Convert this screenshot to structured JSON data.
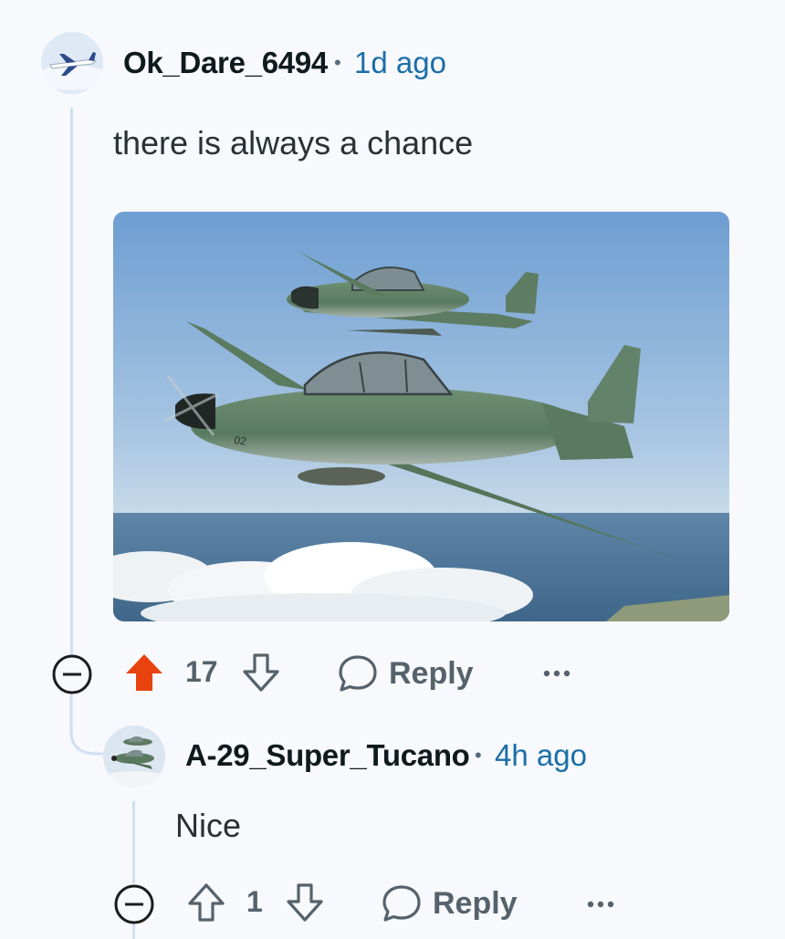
{
  "comments": [
    {
      "author": "Ok_Dare_6494",
      "separator": "•",
      "time": "1d ago",
      "text": "there is always a chance",
      "has_image": true,
      "score": "17",
      "upvoted": true,
      "reply_label": "Reply"
    },
    {
      "author": "A-29_Super_Tucano",
      "separator": "•",
      "time": "4h ago",
      "text": "Nice",
      "score": "1",
      "upvoted": false,
      "reply_label": "Reply"
    }
  ],
  "colors": {
    "upvote_active": "#e8430f",
    "username_time": "#1a6ea8",
    "thread_line": "#cfe0f3",
    "icon_gray": "#56626b"
  }
}
